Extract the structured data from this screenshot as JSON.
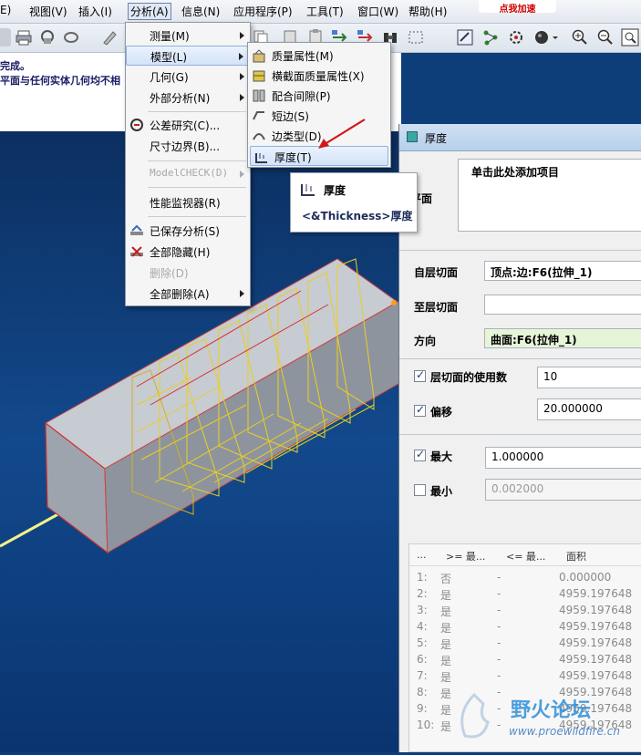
{
  "menubar": {
    "items": [
      "E)",
      "视图(V)",
      "插入(I)",
      "分析(A)",
      "信息(N)",
      "应用程序(P)",
      "工具(T)",
      "窗口(W)",
      "帮助(H)"
    ],
    "badge": "点我加速"
  },
  "message": {
    "line1": "完成。",
    "line2": "平面与任何实体几何均不相"
  },
  "analysis_menu": {
    "items": [
      {
        "label": "测量(M)"
      },
      {
        "label": "模型(L)"
      },
      {
        "label": "几何(G)"
      },
      {
        "label": "外部分析(N)"
      },
      {
        "label": "公差研究(C)..."
      },
      {
        "label": "尺寸边界(B)..."
      },
      {
        "label": "ModelCHECK(D)"
      },
      {
        "label": "性能监视器(R)"
      },
      {
        "label": "已保存分析(S)"
      },
      {
        "label": "全部隐藏(H)"
      },
      {
        "label": "删除(D)"
      },
      {
        "label": "全部删除(A)"
      }
    ]
  },
  "model_menu": {
    "items": [
      {
        "label": "质量属性(M)"
      },
      {
        "label": "横截面质量属性(X)"
      },
      {
        "label": "配合间隙(P)"
      },
      {
        "label": "短边(S)"
      },
      {
        "label": "边类型(D)"
      },
      {
        "label": "厚度(T)"
      }
    ]
  },
  "tooltip": {
    "title": "厚度",
    "description": "<&Thickness>厚度"
  },
  "dialog": {
    "title": "厚度",
    "collector_label": "平面",
    "collector_text": "单击此处添加项目",
    "start_plane_label": "自层切面",
    "start_plane_value": "顶点:边:F6(拉伸_1)",
    "end_plane_label": "至层切面",
    "end_plane_value": "",
    "direction_label": "方向",
    "direction_value": "曲面:F6(拉伸_1)",
    "count_label": "层切面的使用数",
    "count_value": "10",
    "offset_label": "偏移",
    "offset_value": "20.000000",
    "max_label": "最大",
    "max_value": "1.000000",
    "min_label": "最小",
    "min_value": "0.002000",
    "table": {
      "headers": [
        "...",
        ">= 最...",
        "<= 最...",
        "面积"
      ],
      "rows": [
        [
          "1:",
          "否",
          "-",
          "0.000000"
        ],
        [
          "2:",
          "是",
          "-",
          "4959.197648"
        ],
        [
          "3:",
          "是",
          "-",
          "4959.197648"
        ],
        [
          "4:",
          "是",
          "-",
          "4959.197648"
        ],
        [
          "5:",
          "是",
          "-",
          "4959.197648"
        ],
        [
          "6:",
          "是",
          "-",
          "4959.197648"
        ],
        [
          "7:",
          "是",
          "-",
          "4959.197648"
        ],
        [
          "8:",
          "是",
          "-",
          "4959.197648"
        ],
        [
          "9:",
          "是",
          "-",
          "4959.197648"
        ],
        [
          "10:",
          "是",
          "-",
          "4959.197648"
        ]
      ]
    }
  },
  "watermark": {
    "text": "野火论坛",
    "url": "www.proewildfire.cn"
  }
}
